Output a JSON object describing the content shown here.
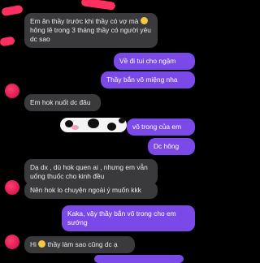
{
  "messages": [
    {
      "id": "m1",
      "dir": "in",
      "text_a": "Em ăn thầy trước khi thầy có vợ mà",
      "emoji": "laughing-emoji",
      "text_b": "hông lẽ trong 3 tháng thầy có người yêu dc sao"
    },
    {
      "id": "m2",
      "dir": "out",
      "text": "Về đi tui cho ngậm"
    },
    {
      "id": "m3",
      "dir": "out",
      "text": "Thầy bắn vô miệng nha"
    },
    {
      "id": "m4",
      "dir": "in",
      "text": "Em hok nuốt dc đâu"
    },
    {
      "id": "m5",
      "dir": "out",
      "text": "vô trong của em",
      "sticker": "cow-pattern-sticker"
    },
    {
      "id": "m6",
      "dir": "out",
      "text": "Dc hông"
    },
    {
      "id": "m7",
      "dir": "in",
      "text": "Dạ dx , dù hok quen ai , nhưng em vẫn uống thuốc cho kinh đều"
    },
    {
      "id": "m8",
      "dir": "in",
      "text": "Nên hok lo chuyện ngoài ý muốn kkk"
    },
    {
      "id": "m9",
      "dir": "out",
      "text": "Kaka, vậy thầy bắn vô trong cho em sướng"
    },
    {
      "id": "m10",
      "dir": "in",
      "text_a": "Hi",
      "emoji": "smiling-emoji",
      "text_b": "thầy làm sao cũng dc ạ"
    }
  ],
  "colors": {
    "background": "#000000",
    "incoming_bubble": "#3a3a3c",
    "outgoing_bubble": "#7b49e8",
    "avatar": "#e0245e"
  }
}
